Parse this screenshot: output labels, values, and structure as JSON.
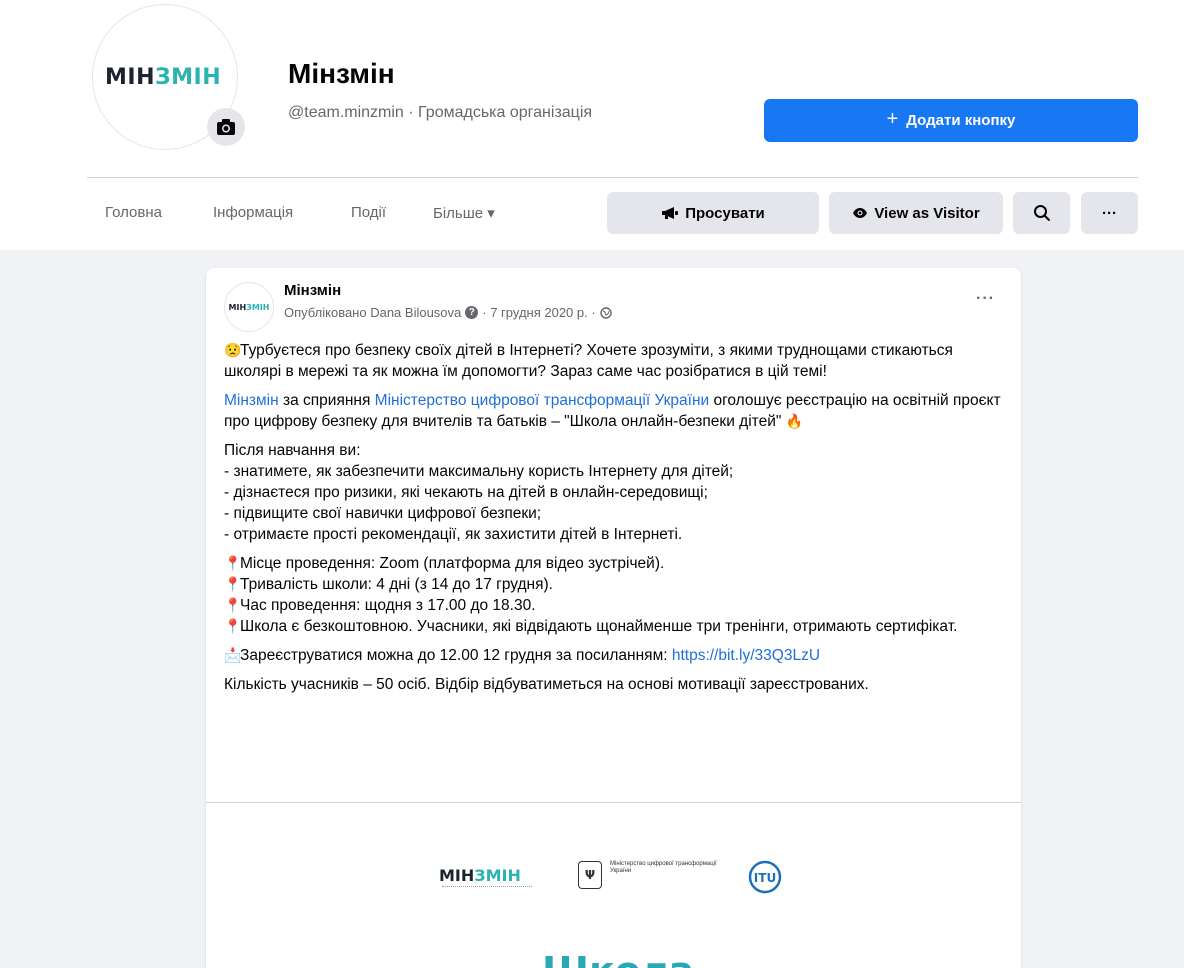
{
  "header": {
    "avatar_logo_a": "МІН",
    "avatar_logo_b": "ЗМІН",
    "page_name": "Мінзмін",
    "page_sub": "@team.minzmin · Громадська організація",
    "add_button": "Додати кнопку",
    "add_button_plus": "+"
  },
  "nav": {
    "tabs": [
      "Головна",
      "Інформація",
      "Події",
      "Більше ▾"
    ],
    "promote_label": "Просувати",
    "visitor_label": "View as Visitor",
    "more_dots": "···"
  },
  "post": {
    "author": "Мінзмін",
    "meta_published": "Опубліковано Dana Bilousova",
    "meta_date": "· 7 грудня 2020 р. ·",
    "more_dots": "···",
    "para1": "Турбуєтеся про безпеку своїх дітей в Інтернеті? Хочете зрозуміти, з якими труднощами стикаються школярі в мережі та як можна їм допомогти? Зараз саме час розібратися в цій темі!",
    "para2_link1": "Мінзмін",
    "para2_mid": " за сприяння ",
    "para2_link2": "Міністерство цифрової трансформації України",
    "para2_rest": " оголошує реєстрацію на освітній проєкт про цифрову безпеку для вчителів та батьків  – \"Школа онлайн-безпеки дітей\"",
    "list_title": "Після навчання ви:",
    "list": [
      "- знатимете, як забезпечити максимальну користь Інтернету для дітей;",
      "- дізнаєтеся про ризики, які чекають на дітей в онлайн-середовищі;",
      "- підвищите свої навички цифрової безпеки;",
      "- отримаєте прості рекомендації, як захистити дітей в Інтернеті."
    ],
    "pins": [
      "Місце проведення: Zoom (платформа для відео зустрічей).",
      "Тривалість школи: 4 дні (з 14 до 17 грудня).",
      "Час проведення: щодня з 17.00 до 18.30.",
      "Школа є безкоштовною. Учасники, які відвідають щонайменше три тренінги, отримають сертифікат."
    ],
    "register_text": "Зареєструватися можна до 12.00 12 грудня за посиланням: ",
    "register_link": "https://bit.ly/33Q3LzU",
    "participants": "Кількість учасників – 50 осіб. Відбір відбуватиметься на основі мотивації зареєстрованих."
  },
  "image": {
    "logo_a": "МІН",
    "logo_b": "ЗМІН",
    "gov_text": "Міністерство цифрової трансформації України",
    "itu": "ITU",
    "school": "Школа"
  },
  "colors": {
    "accent": "#1877f2",
    "link": "#216fdb",
    "teal": "#2bb3b1"
  }
}
